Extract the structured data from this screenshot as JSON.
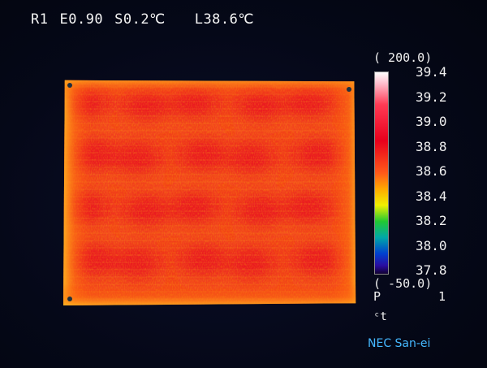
{
  "status": {
    "region": "R1",
    "emissivity": "E0.90",
    "span": "S0.2℃",
    "level": "L38.6℃"
  },
  "scale": {
    "max_label": "( 200.0)",
    "min_label": "( -50.0)",
    "ticks": [
      "39.4",
      "39.2",
      "39.0",
      "38.8",
      "38.6",
      "38.4",
      "38.2",
      "38.0",
      "37.8"
    ],
    "palette": [
      "#ffffff",
      "#ff3b55",
      "#e8001c",
      "#ff5a1a",
      "#ffaa00",
      "#f0f000",
      "#22c832",
      "#00a8a8",
      "#0040d0",
      "#100030"
    ]
  },
  "footer": {
    "p_label": "P",
    "p_value": "1",
    "ct_label": "ᶜt",
    "brand": "NEC San-ei"
  },
  "thermal": {
    "background_color": "#05081a",
    "hot_color": "#e8141e",
    "warm_color": "#ff6a10",
    "edge_color": "#ffb020"
  }
}
